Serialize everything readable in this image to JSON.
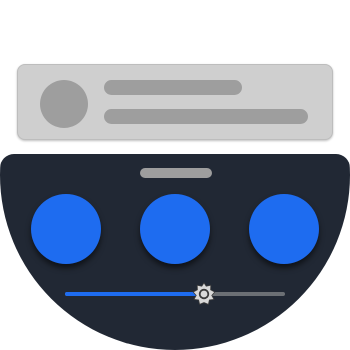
{
  "notification": {
    "avatar_icon": "avatar-placeholder-icon"
  },
  "quick_settings": {
    "buttons": [
      {
        "id": "tile-1",
        "icon": "circle-toggle-icon"
      },
      {
        "id": "tile-2",
        "icon": "circle-toggle-icon"
      },
      {
        "id": "tile-3",
        "icon": "circle-toggle-icon"
      }
    ],
    "brightness": {
      "icon": "brightness-gear-icon",
      "level": 0.63
    }
  },
  "colors": {
    "shade_background": "#212834",
    "accent": "#1e6cf0",
    "card_background": "#cfcfcf",
    "placeholder_gray": "#9e9e9e"
  }
}
